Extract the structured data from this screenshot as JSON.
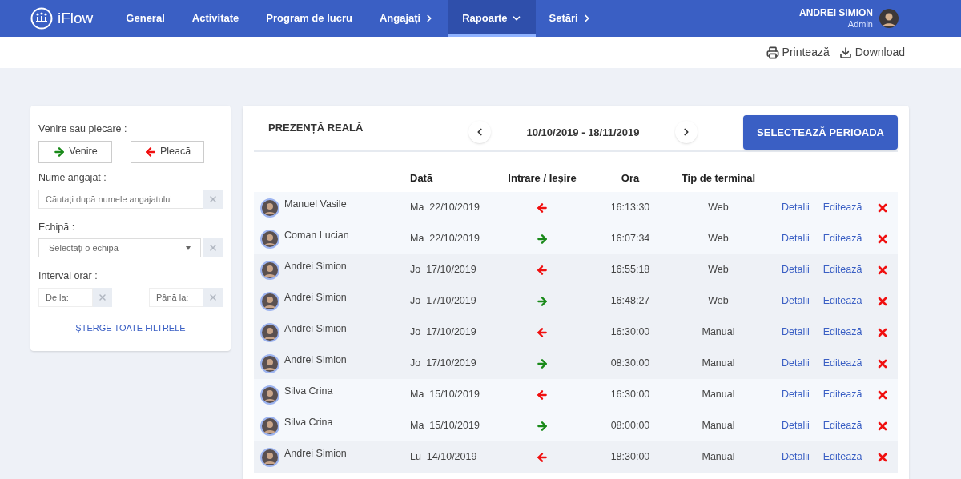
{
  "nav": {
    "logo": "iFlow",
    "items": [
      {
        "label": "General",
        "selected": false,
        "kind": "plain"
      },
      {
        "label": "Activitate",
        "selected": false,
        "kind": "plain"
      },
      {
        "label": "Program de lucru",
        "selected": false,
        "kind": "plain"
      },
      {
        "label": "Angajați",
        "selected": false,
        "kind": "flyout"
      },
      {
        "label": "Rapoarte",
        "selected": true,
        "kind": "dropdown"
      },
      {
        "label": "Setări",
        "selected": false,
        "kind": "flyout"
      }
    ],
    "user": {
      "name": "ANDREI SIMION",
      "role": "Admin"
    }
  },
  "toolbar": {
    "print": "Printează",
    "download": "Download"
  },
  "filters": {
    "direction_label": "Venire sau plecare :",
    "in_button": "Venire",
    "out_button": "Pleacă",
    "name_label": "Nume angajat :",
    "name_placeholder": "Căutați după numele angajatului",
    "team_label": "Echipă :",
    "team_placeholder": "Selectați o echipă",
    "interval_label": "Interval orar :",
    "from_placeholder": "De la:",
    "to_placeholder": "Până la:",
    "clear": "ȘTERGE TOATE FILTRELE"
  },
  "report": {
    "title": "PREZENȚĂ REALĂ",
    "period": "10/10/2019 - 18/11/2019",
    "select_button": "SELECTEAZĂ PERIOADA",
    "columns": [
      "Dată",
      "Intrare / Ieșire",
      "Ora",
      "Tip de terminal"
    ],
    "rows": [
      {
        "name": "Manuel Vasile",
        "day": "Ma",
        "date": "22/10/2019",
        "kind": "out",
        "time": "16:13:30",
        "terminal": "Web",
        "details": "Detalii",
        "edit": "Editează"
      },
      {
        "name": "Coman Lucian",
        "day": "Ma",
        "date": "22/10/2019",
        "kind": "in",
        "time": "16:07:34",
        "terminal": "Web",
        "details": "Detalii",
        "edit": "Editează"
      },
      {
        "name": "Andrei Simion",
        "day": "Jo",
        "date": "17/10/2019",
        "kind": "out",
        "time": "16:55:18",
        "terminal": "Web",
        "details": "Detalii",
        "edit": "Editează"
      },
      {
        "name": "Andrei Simion",
        "day": "Jo",
        "date": "17/10/2019",
        "kind": "in",
        "time": "16:48:27",
        "terminal": "Web",
        "details": "Detalii",
        "edit": "Editează"
      },
      {
        "name": "Andrei Simion",
        "day": "Jo",
        "date": "17/10/2019",
        "kind": "out",
        "time": "16:30:00",
        "terminal": "Manual",
        "details": "Detalii",
        "edit": "Editează"
      },
      {
        "name": "Andrei Simion",
        "day": "Jo",
        "date": "17/10/2019",
        "kind": "in",
        "time": "08:30:00",
        "terminal": "Manual",
        "details": "Detalii",
        "edit": "Editează"
      },
      {
        "name": "Silva Crina",
        "day": "Ma",
        "date": "15/10/2019",
        "kind": "out",
        "time": "16:30:00",
        "terminal": "Manual",
        "details": "Detalii",
        "edit": "Editează"
      },
      {
        "name": "Silva Crina",
        "day": "Ma",
        "date": "15/10/2019",
        "kind": "in",
        "time": "08:00:00",
        "terminal": "Manual",
        "details": "Detalii",
        "edit": "Editează"
      },
      {
        "name": "Andrei Simion",
        "day": "Lu",
        "date": "14/10/2019",
        "kind": "out",
        "time": "18:30:00",
        "terminal": "Manual",
        "details": "Detalii",
        "edit": "Editează"
      }
    ]
  }
}
